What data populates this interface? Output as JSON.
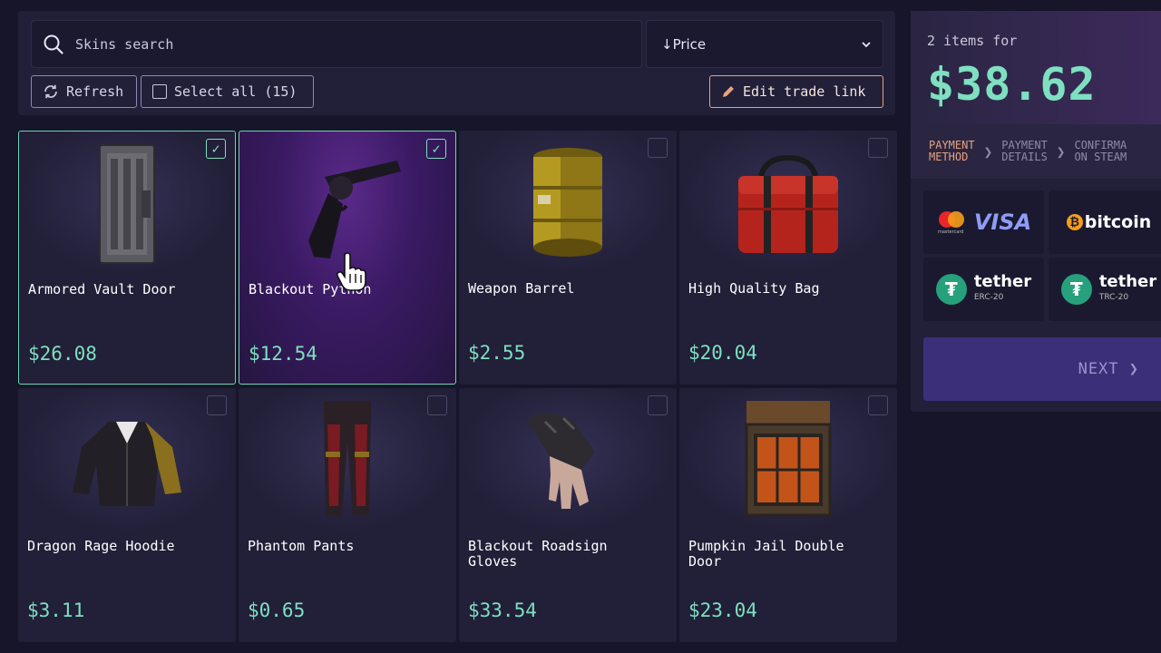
{
  "search": {
    "placeholder": "Skins search"
  },
  "sort": {
    "label": "↓Price"
  },
  "toolbar": {
    "refresh_label": "Refresh",
    "select_all_label": "Select all (15)",
    "edit_trade_link_label": "Edit trade link"
  },
  "items": [
    {
      "name": "Armored Vault Door",
      "price": "$26.08",
      "selected": true
    },
    {
      "name": "Blackout Python",
      "price": "$12.54",
      "selected": true
    },
    {
      "name": "Weapon Barrel",
      "price": "$2.55",
      "selected": false
    },
    {
      "name": "High Quality Bag",
      "price": "$20.04",
      "selected": false
    },
    {
      "name": "Dragon Rage Hoodie",
      "price": "$3.11",
      "selected": false
    },
    {
      "name": "Phantom Pants",
      "price": "$0.65",
      "selected": false
    },
    {
      "name": "Blackout Roadsign Gloves",
      "price": "$33.54",
      "selected": false
    },
    {
      "name": "Pumpkin Jail Double Door",
      "price": "$23.04",
      "selected": false
    }
  ],
  "checkout": {
    "count_label": "2 items for",
    "total": "$38.62",
    "steps": [
      {
        "line1": "PAYMENT",
        "line2": "METHOD"
      },
      {
        "line1": "PAYMENT",
        "line2": "DETAILS"
      },
      {
        "line1": "CONFIRMA",
        "line2": "ON STEAM"
      }
    ],
    "payment_methods": [
      {
        "label": "VISA",
        "sub": "mastercard"
      },
      {
        "label": "bitcoin",
        "sub": ""
      },
      {
        "label": "tether",
        "sub": "ERC-20"
      },
      {
        "label": "tether",
        "sub": "TRC-20"
      }
    ],
    "next_label": "NEXT ❯"
  },
  "colors": {
    "accent": "#7ee0c0",
    "orange": "#e9a27c",
    "background": "#17152a",
    "panel": "#221f38"
  }
}
